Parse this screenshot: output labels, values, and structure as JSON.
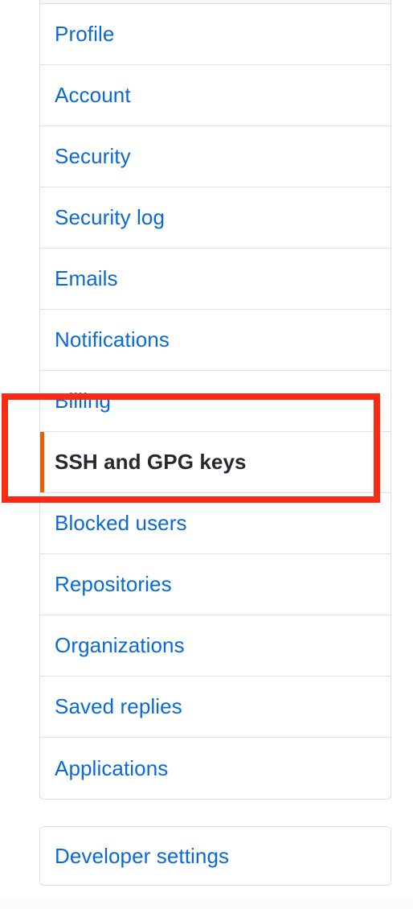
{
  "page": {
    "kind": "github-user-settings-sidebar",
    "background_color": "#ffffff"
  },
  "colors": {
    "link_blue": "#0969da",
    "selected_text": "#24292f",
    "selected_accent": "#e36209",
    "border": "#d8dee4",
    "divider": "#dde1e6",
    "card_header_bg": "#f6f8fa",
    "annotation_red": "#fa2b15"
  },
  "sidebar": {
    "items": [
      {
        "label": "Profile",
        "selected": false
      },
      {
        "label": "Account",
        "selected": false
      },
      {
        "label": "Security",
        "selected": false
      },
      {
        "label": "Security log",
        "selected": false
      },
      {
        "label": "Emails",
        "selected": false
      },
      {
        "label": "Notifications",
        "selected": false
      },
      {
        "label": "Billing",
        "selected": false
      },
      {
        "label": "SSH and GPG keys",
        "selected": true
      },
      {
        "label": "Blocked users",
        "selected": false
      },
      {
        "label": "Repositories",
        "selected": false
      },
      {
        "label": "Organizations",
        "selected": false
      },
      {
        "label": "Saved replies",
        "selected": false
      },
      {
        "label": "Applications",
        "selected": false
      }
    ]
  },
  "developer": {
    "items": [
      {
        "label": "Developer settings",
        "selected": false
      }
    ]
  },
  "annotation": {
    "target_label": "SSH and GPG keys",
    "shape": "rectangle",
    "color": "#fa2b15"
  }
}
